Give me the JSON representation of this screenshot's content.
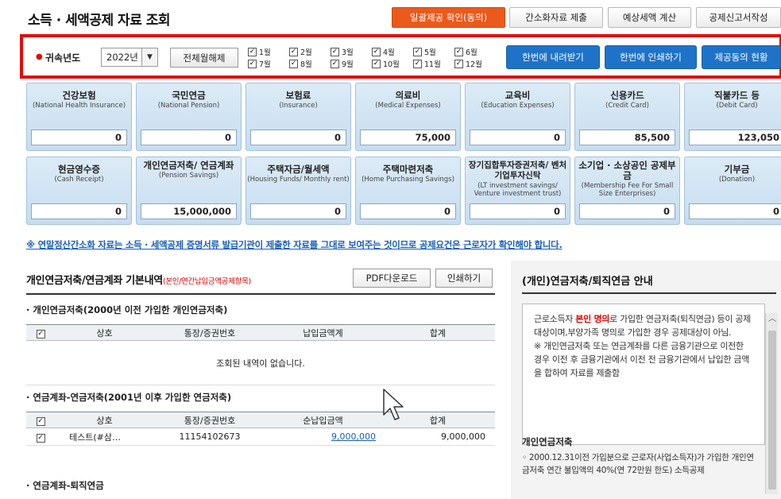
{
  "header": {
    "title": "소득 · 세액공제 자료 조회",
    "buttons": [
      "일괄제공 확인(동의)",
      "간소화자료 제출",
      "예상세액 계산",
      "공제신고서작성"
    ]
  },
  "filter": {
    "year_label": "귀속년도",
    "year_value": "2022년",
    "toggle_all": "전체월해제",
    "months": [
      "1월",
      "2월",
      "3월",
      "4월",
      "5월",
      "6월",
      "7월",
      "8월",
      "9월",
      "10월",
      "11월",
      "12월"
    ],
    "actions": [
      "한번에 내려받기",
      "한번에 인쇄하기",
      "제공동의 현황"
    ]
  },
  "cards": [
    {
      "kr": "건강보험",
      "en": "(National Health Insurance)",
      "value": "0"
    },
    {
      "kr": "국민연금",
      "en": "(National Pension)",
      "value": "0"
    },
    {
      "kr": "보험료",
      "en": "(Insurance)",
      "value": "0"
    },
    {
      "kr": "의료비",
      "en": "(Medical Expenses)",
      "value": "75,000"
    },
    {
      "kr": "교육비",
      "en": "(Education Expenses)",
      "value": "0"
    },
    {
      "kr": "신용카드",
      "en": "(Credit Card)",
      "value": "85,500"
    },
    {
      "kr": "직불카드 등",
      "en": "(Debit Card)",
      "value": "123,050"
    },
    {
      "kr": "현금영수증",
      "en": "(Cash Receipt)",
      "value": "0"
    },
    {
      "kr": "개인연금저축/ 연금계좌",
      "en": "(Pension Savings)",
      "value": "15,000,000"
    },
    {
      "kr": "주택자금/월세액",
      "en": "(Housing Funds/ Monthly rent)",
      "value": "0"
    },
    {
      "kr": "주택마련저축",
      "en": "(Home Purchasing Savings)",
      "value": "0"
    },
    {
      "kr": "장기집합투자증권저축/ 벤처기업투자신탁",
      "en": "(LT investment savings/ Venture investment trust)",
      "value": "0"
    },
    {
      "kr": "소기업 · 소상공인 공제부금",
      "en": "(Membership Fee For Small Size Enterprises)",
      "value": "0"
    },
    {
      "kr": "기부금",
      "en": "(Donation)",
      "value": "0"
    }
  ],
  "notice": "※ 연말정산간소화 자료는 소득 · 세액공제 증명서류 발급기관이 제출한 자료를 그대로 보여주는 것이므로 공제요건은 근로자가 확인해야 합니다.",
  "left": {
    "title": "개인연금저축/연금계좌 기본내역",
    "title_note": "(본인/연간납입금액공제항목)",
    "pdf_btn": "PDF다운로드",
    "print_btn": "인쇄하기",
    "section1": {
      "title": "· 개인연금저축(2000년 이전 가입한 개인연금저축)",
      "headers": [
        "상호",
        "통장/증권번호",
        "납입금액계",
        "합계"
      ],
      "empty": "조회된 내역이 없습니다."
    },
    "section2": {
      "title": "· 연금계좌-연금저축(2001년 이후 가입한 연금저축)",
      "headers": [
        "상호",
        "통장/증권번호",
        "순납입금액",
        "합계"
      ],
      "row": {
        "name": "테스트(#삼…",
        "account": "11154102673",
        "amount": "9,000,000",
        "total": "9,000,000"
      }
    },
    "section3": {
      "title": "· 연금계좌-퇴직연금"
    }
  },
  "right": {
    "title": "(개인)연금저축/퇴직연금 안내",
    "guide_pre": "근로소득자 ",
    "guide_red": "본인 명의",
    "guide_post": "로 가입한 연금저축(퇴직연금) 등이 공제 대상이며,부양가족 명의로 가입한 경우 공제대상이 아님.",
    "guide_note": "※ 개인연금저축 또는 연금계좌를 다른 금융기관으로 이전한 경우 이전 후 금융기관에서 이전 전 금융기관에서 납입한 금액을 합하여 자료를 제출함",
    "sub_title": "개인연금저축",
    "sub_text": "◦ 2000.12.31이전 가입분으로 근로자(사업소득자)가 가입한 개인연금저축 연간 불입액의 40%(연 72만원 한도) 소득공제"
  }
}
